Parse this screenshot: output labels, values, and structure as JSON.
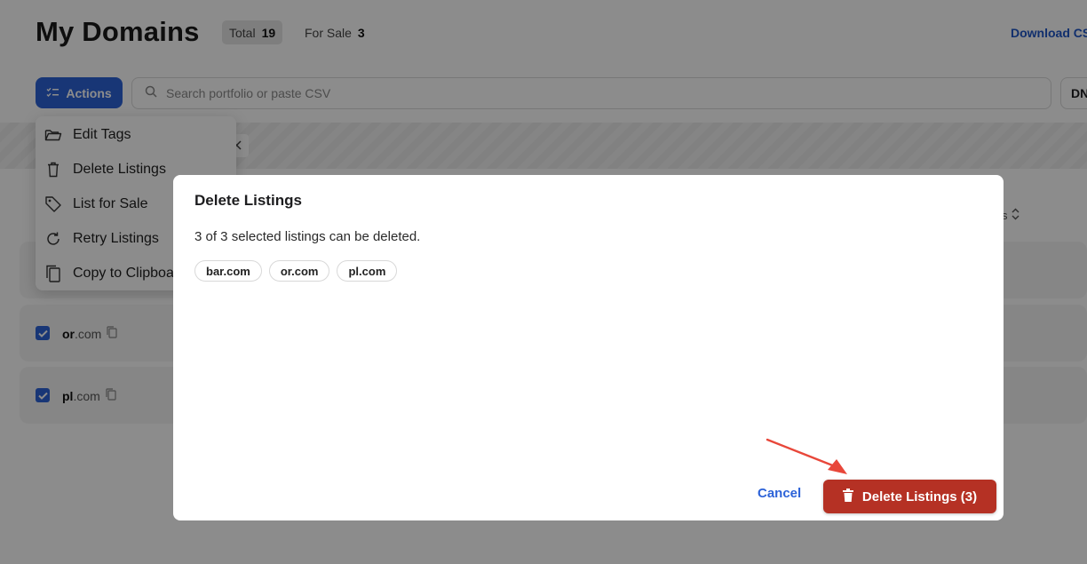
{
  "header": {
    "title": "My Domains",
    "total_label": "Total",
    "total_count": "19",
    "for_sale_label": "For Sale",
    "for_sale_count": "3",
    "download_link": "Download CSV"
  },
  "toolbar": {
    "actions_label": "Actions",
    "search_placeholder": "Search portfolio or paste CSV",
    "dns_label": "DNS"
  },
  "filter": {
    "chip_label": "s"
  },
  "table": {
    "sort_label": "s"
  },
  "rows": [
    {
      "name": "or",
      "tld": ".com",
      "checked": true
    },
    {
      "name": "pl",
      "tld": ".com",
      "checked": true
    }
  ],
  "actions_menu": {
    "items": [
      {
        "label": "Edit Tags",
        "icon": "folder-icon"
      },
      {
        "label": "Delete Listings",
        "icon": "trash-icon"
      },
      {
        "label": "List for Sale",
        "icon": "tag-icon"
      },
      {
        "label": "Retry Listings",
        "icon": "refresh-icon"
      },
      {
        "label": "Copy to Clipboard",
        "icon": "copy-icon"
      }
    ]
  },
  "modal": {
    "title": "Delete Listings",
    "message": "3 of 3 selected listings can be deleted.",
    "domains": [
      "bar.com",
      "or.com",
      "pl.com"
    ],
    "cancel_label": "Cancel",
    "delete_label": "Delete Listings (3)"
  },
  "colors": {
    "accent": "#2d63d8",
    "danger": "#b53124",
    "annotation_arrow": "#e8473a"
  }
}
